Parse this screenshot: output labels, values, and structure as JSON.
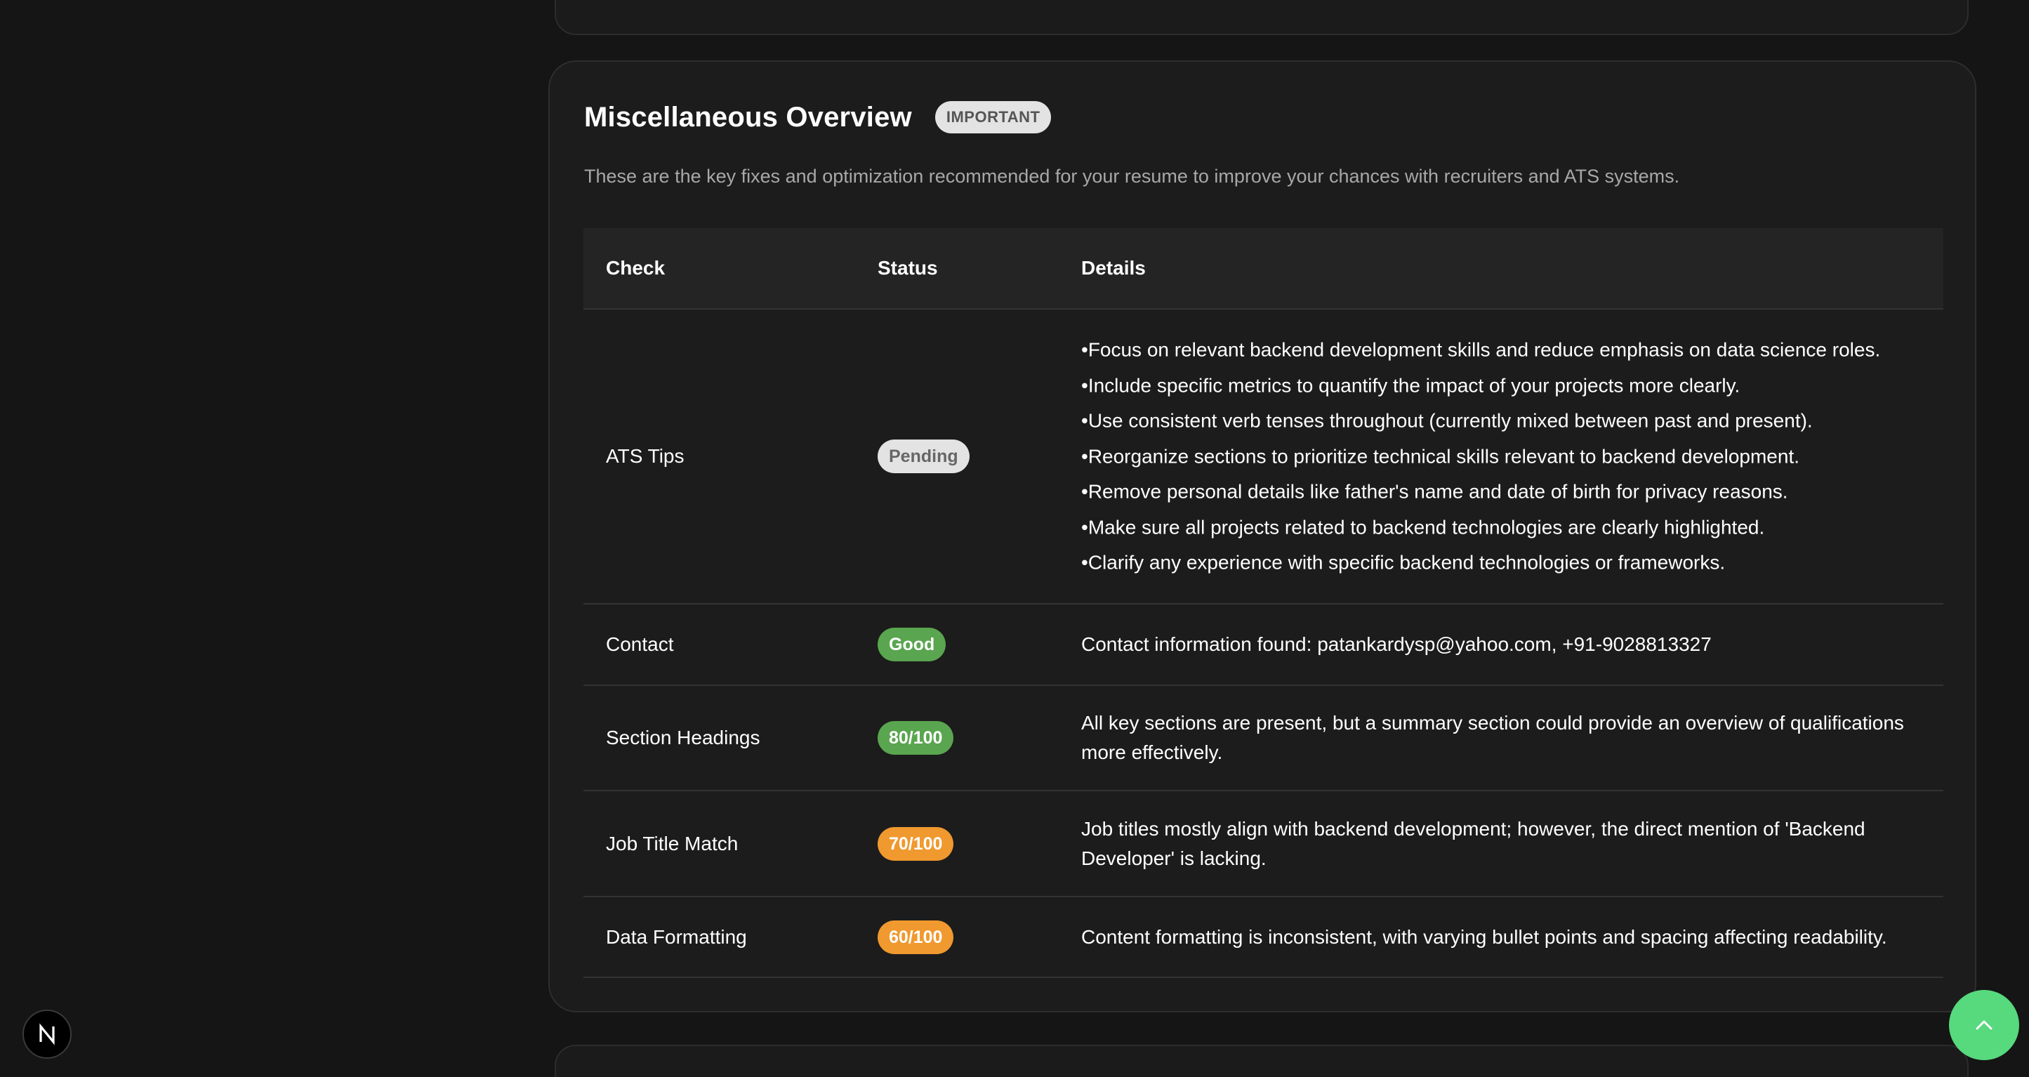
{
  "overview": {
    "title": "Miscellaneous Overview",
    "badge": "IMPORTANT",
    "description": "These are the key fixes and optimization recommended for your resume to improve your chances with recruiters and ATS systems."
  },
  "table": {
    "headers": {
      "check": "Check",
      "status": "Status",
      "details": "Details"
    },
    "rows": [
      {
        "check": "ATS Tips",
        "status": "Pending",
        "tips": [
          "Focus on relevant backend development skills and reduce emphasis on data science roles.",
          "Include specific metrics to quantify the impact of your projects more clearly.",
          "Use consistent verb tenses throughout (currently mixed between past and present).",
          "Reorganize sections to prioritize technical skills relevant to backend development.",
          "Remove personal details like father's name and date of birth for privacy reasons.",
          "Make sure all projects related to backend technologies are clearly highlighted.",
          "Clarify any experience with specific backend technologies or frameworks."
        ]
      },
      {
        "check": "Contact",
        "status": "Good",
        "details": "Contact information found: patankardysp@yahoo.com, +91-9028813327"
      },
      {
        "check": "Section Headings",
        "status": "80/100",
        "details": "All key sections are present, but a summary section could provide an overview of qualifications more effectively."
      },
      {
        "check": "Job Title Match",
        "status": "70/100",
        "details": "Job titles mostly align with backend development; however, the direct mention of 'Backend Developer' is lacking."
      },
      {
        "check": "Data Formatting",
        "status": "60/100",
        "details": "Content formatting is inconsistent, with varying bullet points and spacing affecting readability."
      }
    ]
  },
  "colors": {
    "background": "#151515",
    "card": "#1c1c1c",
    "good": "#5aa54f",
    "warning": "#f0992f",
    "pending": "#e3e3e3",
    "fab": "#57d97e"
  },
  "icons": {
    "scroll_top": "chevron-up-icon",
    "framework_logo": "n-logo-icon"
  }
}
